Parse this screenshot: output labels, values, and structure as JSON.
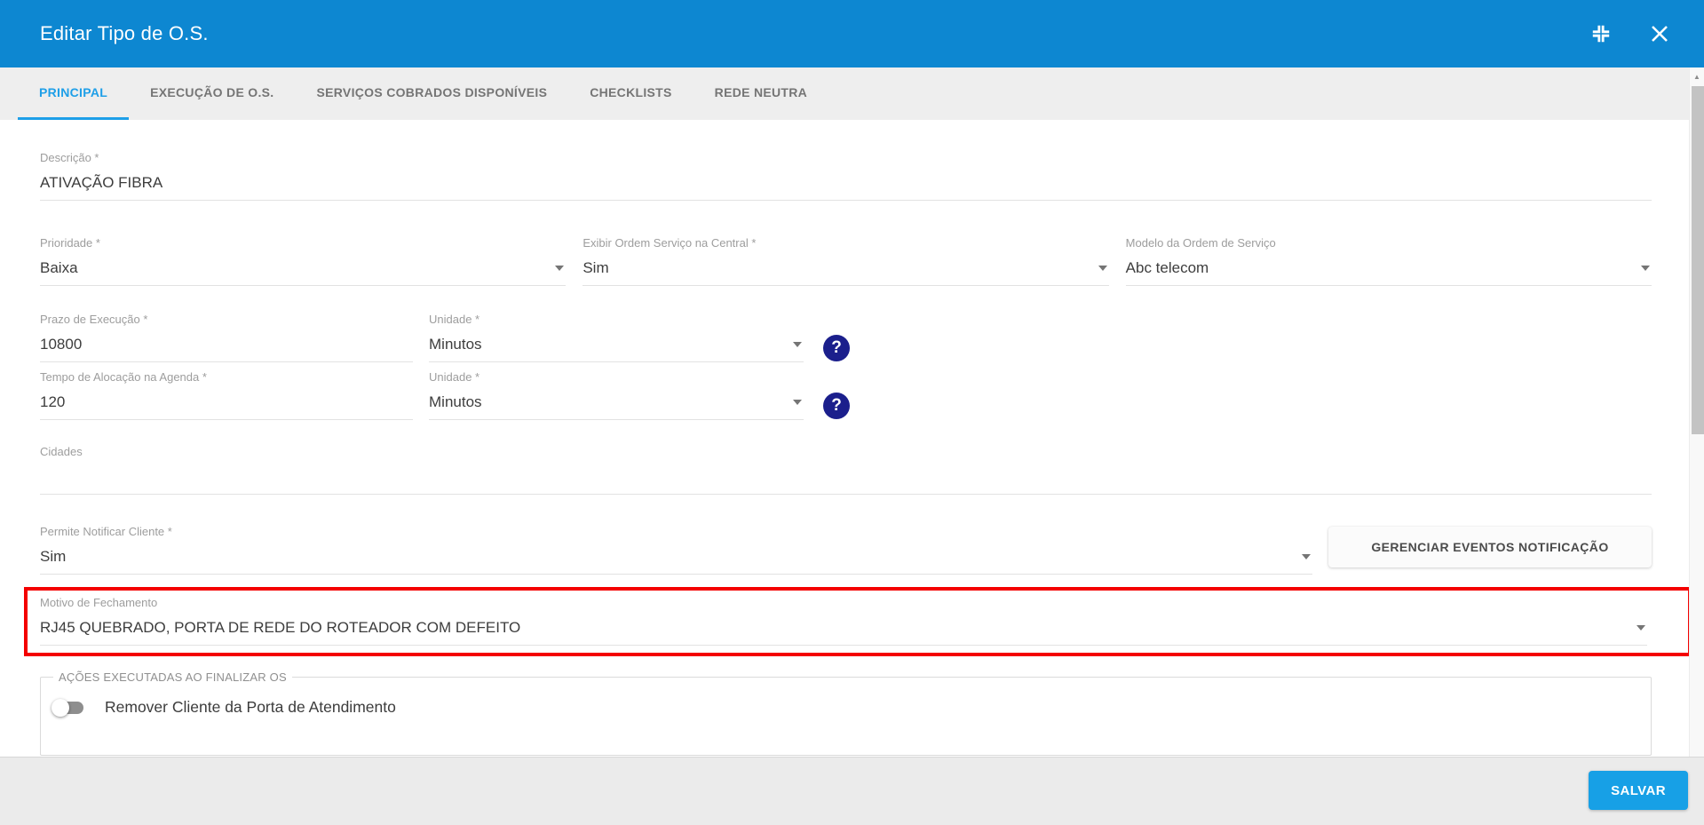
{
  "header": {
    "title": "Editar Tipo de O.S."
  },
  "tabs": [
    {
      "label": "PRINCIPAL",
      "active": true
    },
    {
      "label": "EXECUÇÃO DE O.S.",
      "active": false
    },
    {
      "label": "SERVIÇOS COBRADOS DISPONÍVEIS",
      "active": false
    },
    {
      "label": "CHECKLISTS",
      "active": false
    },
    {
      "label": "REDE NEUTRA",
      "active": false
    }
  ],
  "form": {
    "descricao": {
      "label": "Descrição *",
      "value": "ATIVAÇÃO FIBRA"
    },
    "prioridade": {
      "label": "Prioridade *",
      "value": "Baixa"
    },
    "exibir_central": {
      "label": "Exibir Ordem Serviço na Central *",
      "value": "Sim"
    },
    "modelo_os": {
      "label": "Modelo da Ordem de Serviço",
      "value": "Abc telecom"
    },
    "prazo_execucao": {
      "label": "Prazo de Execução *",
      "value": "10800"
    },
    "unidade_prazo": {
      "label": "Unidade *",
      "value": "Minutos"
    },
    "tempo_alocacao": {
      "label": "Tempo de Alocação na Agenda *",
      "value": "120"
    },
    "unidade_tempo": {
      "label": "Unidade *",
      "value": "Minutos"
    },
    "cidades": {
      "label": "Cidades",
      "value": ""
    },
    "permite_notificar": {
      "label": "Permite Notificar Cliente *",
      "value": "Sim"
    },
    "gerenciar_button": "GERENCIAR EVENTOS NOTIFICAÇÃO",
    "motivo_fechamento": {
      "label": "Motivo de Fechamento",
      "value": "RJ45 QUEBRADO, PORTA DE REDE DO ROTEADOR COM DEFEITO",
      "highlighted": true
    },
    "acoes_section": {
      "legend": "AÇÕES EXECUTADAS AO FINALIZAR OS",
      "toggle_label": "Remover Cliente da Porta de Atendimento",
      "toggle_state": "off"
    }
  },
  "footer": {
    "save_label": "SALVAR"
  },
  "icons": {
    "compress": "compress-arrows",
    "close": "x-mark",
    "help": "question-mark-circle",
    "dropdown": "caret-down",
    "scroll_up": "triangle-up"
  },
  "colors": {
    "header_blue": "#0d87d1",
    "accent_blue": "#1e9fe8",
    "save_blue": "#17a0e6",
    "highlight_red": "#f40000",
    "help_navy": "#1b1f8c"
  }
}
